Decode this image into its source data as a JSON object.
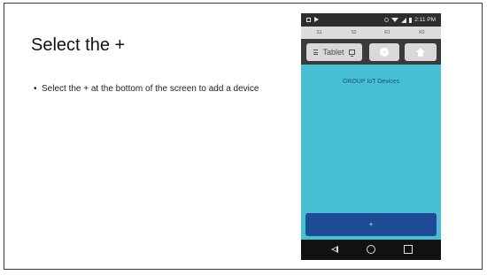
{
  "slide": {
    "title": "Select the +",
    "bullets": [
      {
        "text": "Select the + at the bottom of the screen to add a device"
      }
    ]
  },
  "phone": {
    "status_bar": {
      "time": "2:11 PM",
      "icons": [
        "screenshot-icon",
        "play-store-icon",
        "alarm-icon",
        "wifi-icon",
        "signal-icon",
        "battery-icon"
      ]
    },
    "tabs": [
      "S1",
      "S2",
      "R1",
      "R2"
    ],
    "toolbar": {
      "tablet_label": "Tablet",
      "icons": [
        "menu-icon",
        "tablet-icon",
        "gear-icon",
        "home-icon"
      ]
    },
    "content_title": "GROUP IoT Devices",
    "add_button_label": "+",
    "nav_icons": [
      "back-icon",
      "home-circle-icon",
      "recent-apps-icon"
    ]
  },
  "colors": {
    "background": "#48c0d3",
    "toolbar": "#3a3a3a",
    "add_button": "#1e4a96",
    "content_title": "#1f4a8a"
  }
}
